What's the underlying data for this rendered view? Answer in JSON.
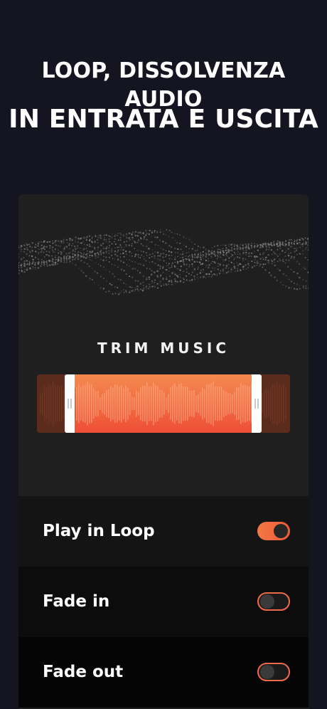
{
  "header": {
    "line1": "LOOP, DISSOLVENZA AUDIO",
    "line2": "IN ENTRATA E USCITA"
  },
  "editor": {
    "trim_title": "TRIM MUSIC"
  },
  "settings": [
    {
      "label": "Play in Loop",
      "enabled": true
    },
    {
      "label": "Fade in",
      "enabled": false
    },
    {
      "label": "Fade out",
      "enabled": false
    }
  ],
  "colors": {
    "background": "#151521",
    "card": "#1f1f20",
    "accent": "#ef6b47"
  }
}
